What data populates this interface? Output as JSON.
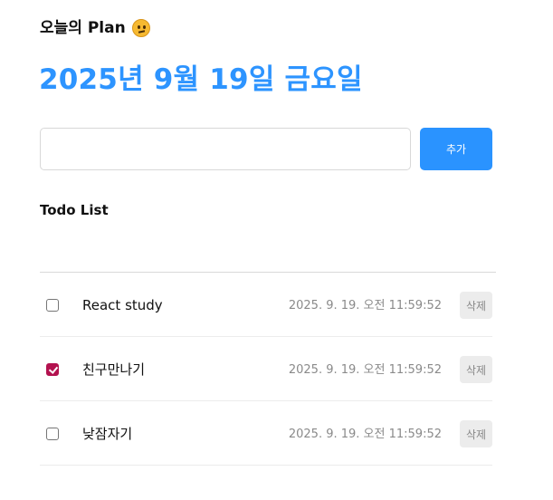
{
  "header": {
    "brand_text": "오늘의 Plan",
    "brand_emoji_icon": "thinking-face-emoji",
    "date_heading": "2025년 9월 19일 금요일",
    "accent_color": "#2d94ff"
  },
  "editor": {
    "input_value": "",
    "input_placeholder": "",
    "add_button_label": "추가",
    "button_color": "#2a93ff"
  },
  "list": {
    "title": "Todo List",
    "items": [
      {
        "content": "React study",
        "date": "2025. 9. 19. 오전 11:59:52",
        "done": false,
        "delete_label": "삭제"
      },
      {
        "content": "친구만나기",
        "date": "2025. 9. 19. 오전 11:59:52",
        "done": true,
        "delete_label": "삭제"
      },
      {
        "content": "낮잠자기",
        "date": "2025. 9. 19. 오전 11:59:52",
        "done": false,
        "delete_label": "삭제"
      }
    ]
  }
}
